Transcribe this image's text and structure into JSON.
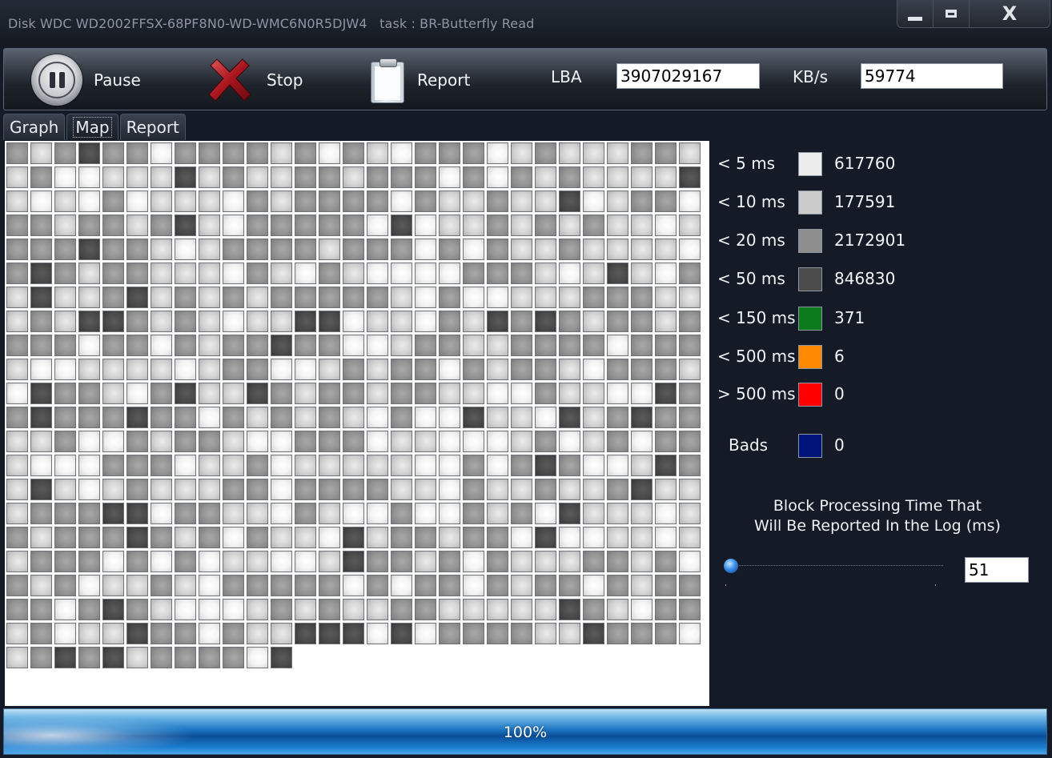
{
  "window": {
    "title": "Disk WDC WD2002FFSX-68PF8N0-WD-WMC6N0R5DJW4   task : BR-Butterfly Read"
  },
  "toolbar": {
    "pause_label": "Pause",
    "stop_label": "Stop",
    "report_label": "Report",
    "lba_label": "LBA",
    "lba_value": "3907029167",
    "kbs_label": "KB/s",
    "kbs_value": "59774"
  },
  "tabs": [
    {
      "label": "Graph"
    },
    {
      "label": "Map"
    },
    {
      "label": "Report"
    }
  ],
  "active_tab": "Map",
  "legend": [
    {
      "label": "< 5 ms",
      "color": "#ececec",
      "count": "617760"
    },
    {
      "label": "< 10 ms",
      "color": "#cbcbcb",
      "count": "177591"
    },
    {
      "label": "< 20 ms",
      "color": "#8e8e8e",
      "count": "2172901"
    },
    {
      "label": "< 50 ms",
      "color": "#4b4b4b",
      "count": "846830"
    },
    {
      "label": "< 150 ms",
      "color": "#0a7a1a",
      "count": "371"
    },
    {
      "label": "< 500 ms",
      "color": "#ff8a00",
      "count": "6"
    },
    {
      "label": "> 500 ms",
      "color": "#ff0000",
      "count": "0"
    },
    {
      "label": "Bads",
      "color": "#00147a",
      "count": "0"
    }
  ],
  "threshold": {
    "title_line1": "Block Processing Time That",
    "title_line2": "Will Be Reported In the Log (ms)",
    "value": "51"
  },
  "progress": {
    "percent": 100,
    "text": "100%"
  }
}
